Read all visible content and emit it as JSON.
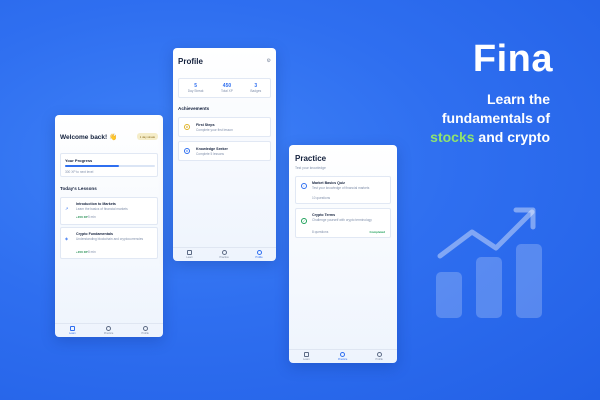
{
  "brand": {
    "name": "Fina",
    "tagline_line1": "Learn the",
    "tagline_line2": "fundamentals of",
    "tagline_highlight_stocks": "stocks",
    "tagline_and": "and",
    "tagline_highlight_crypto": "crypto",
    "highlight_color": "#8fe36f"
  },
  "home": {
    "welcome": "Welcome back! 👋",
    "streak_badge": "1 day streak",
    "progress_title": "Your Progress",
    "progress_fraction": 0.6,
    "progress_caption": "300 XP to next level",
    "lessons_title": "Today's Lessons",
    "lessons": [
      {
        "icon": "trend-icon",
        "title": "Introduction to Markets",
        "desc": "Learn the basics of financial markets",
        "xp": "+150 XP",
        "meta": "5 min"
      },
      {
        "icon": "coin-icon",
        "title": "Crypto Fundamentals",
        "desc": "Understanding blockchain and cryptocurrencies",
        "xp": "+150 XP",
        "meta": "8 min"
      }
    ]
  },
  "profile": {
    "title": "Profile",
    "stats": [
      {
        "value": "5",
        "label": "Day Streak"
      },
      {
        "value": "450",
        "label": "Total XP"
      },
      {
        "value": "3",
        "label": "Badges"
      }
    ],
    "achievements_title": "Achievements",
    "achievements": [
      {
        "icon": "trophy-icon",
        "title": "First Steps",
        "desc": "Complete your first lesson"
      },
      {
        "icon": "star-icon",
        "title": "Knowledge Seeker",
        "desc": "Complete 5 lessons"
      }
    ]
  },
  "practice": {
    "title": "Practice",
    "subtitle": "Test your knowledge",
    "quizzes": [
      {
        "title": "Market Basics Quiz",
        "desc": "Test your knowledge of financial markets",
        "meta": "10 questions",
        "status": ""
      },
      {
        "title": "Crypto Terms",
        "desc": "Challenge yourself with crypto terminology",
        "meta": "8 questions",
        "status": "Completed"
      }
    ]
  },
  "nav": {
    "learn": "Learn",
    "practice": "Practice",
    "profile": "Profile"
  }
}
